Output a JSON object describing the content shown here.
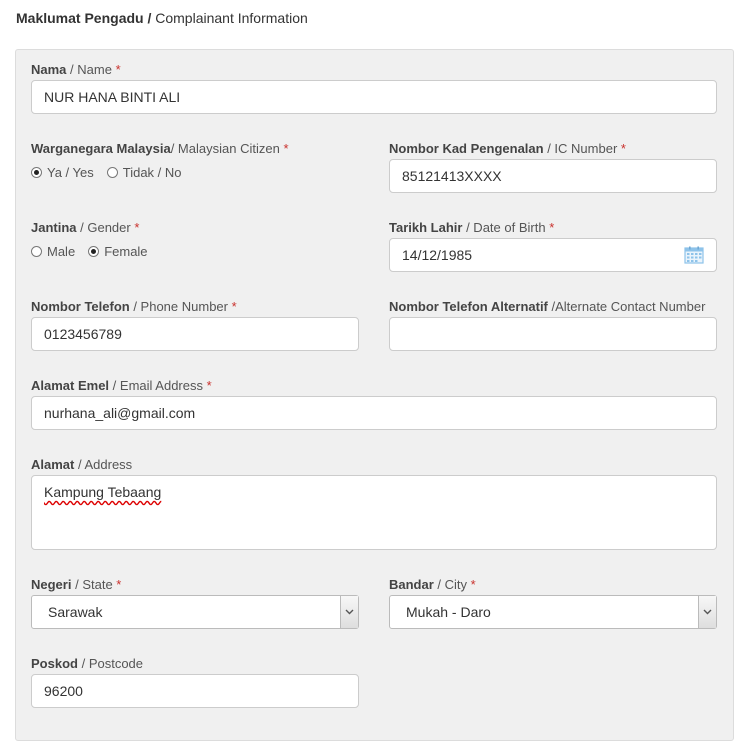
{
  "section": {
    "title_bold": "Maklumat Pengadu /",
    "title_rest": "Complainant Information"
  },
  "form": {
    "name": {
      "label_bold": "Nama",
      "label_rest": "/ Name",
      "required": "*",
      "value": "NUR HANA BINTI ALI"
    },
    "citizen": {
      "label_bold": "Warganegara Malaysia",
      "label_rest": "/ Malaysian Citizen",
      "required": "*",
      "options": [
        {
          "label": "Ya / Yes",
          "checked": true
        },
        {
          "label": "Tidak / No",
          "checked": false
        }
      ]
    },
    "ic": {
      "label_bold": "Nombor Kad Pengenalan",
      "label_rest": " / IC Number",
      "required": "*",
      "value": "85121413XXXX"
    },
    "gender": {
      "label_bold": "Jantina",
      "label_rest": "/ Gender",
      "required": "*",
      "options": [
        {
          "label": "Male",
          "checked": false
        },
        {
          "label": "Female",
          "checked": true
        }
      ]
    },
    "dob": {
      "label_bold": "Tarikh Lahir",
      "label_rest": "/ Date of Birth",
      "required": "*",
      "value": "14/12/1985",
      "icon": "calendar-icon"
    },
    "phone": {
      "label_bold": "Nombor Telefon",
      "label_rest": "/ Phone Number",
      "required": "*",
      "value": "0123456789"
    },
    "alt_phone": {
      "label_bold": "Nombor Telefon Alternatif",
      "label_rest": "/Alternate Contact Number",
      "value": ""
    },
    "email": {
      "label_bold": "Alamat Emel",
      "label_rest": "/ Email Address",
      "required": "*",
      "value": "nurhana_ali@gmail.com"
    },
    "address": {
      "label_bold": "Alamat",
      "label_rest": "/ Address",
      "value": "Kampung Tebaang"
    },
    "state": {
      "label_bold": "Negeri",
      "label_rest": "/ State",
      "required": "*",
      "value": "Sarawak"
    },
    "city": {
      "label_bold": "Bandar",
      "label_rest": "/ City",
      "required": "*",
      "value": "Mukah - Daro"
    },
    "postcode": {
      "label_bold": "Poskod",
      "label_rest": "/ Postcode",
      "value": "96200"
    }
  },
  "colors": {
    "panel_bg": "#f0f0f0",
    "required": "#c9302c",
    "calendar_icon": "#8ec3ea"
  }
}
